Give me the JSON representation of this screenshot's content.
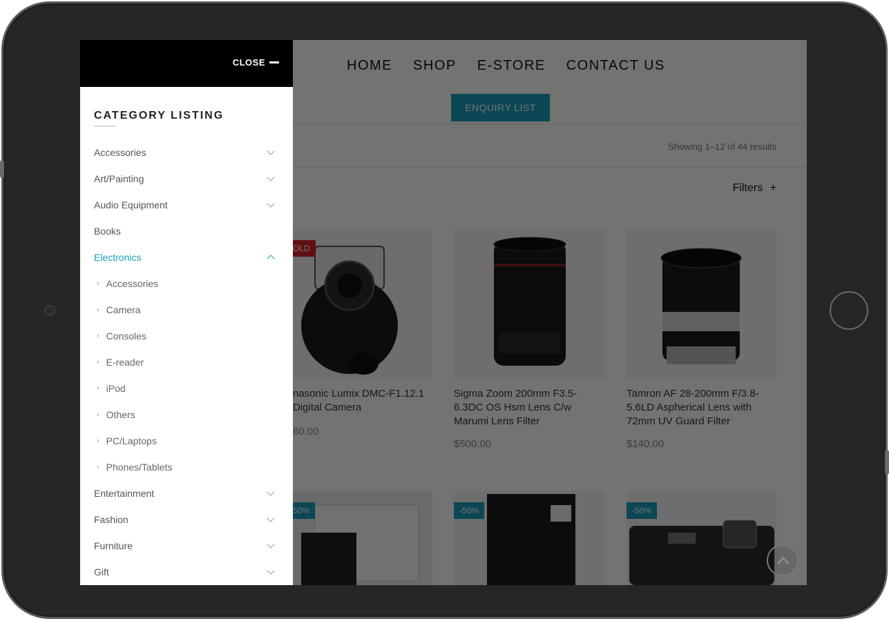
{
  "nav": {
    "items": [
      "HOME",
      "SHOP",
      "E-STORE",
      "CONTACT US"
    ]
  },
  "enquiry_label": "ENQUIRY LIST",
  "results_text": "Showing 1–12 of 44 results",
  "filters_label": "Filters",
  "filters_icon": "+",
  "products": [
    {
      "title": "nasonic Lumix DMC-F1.12.1 Digital Camera",
      "price": "60.00",
      "badge": "OLD",
      "badge_color": "#d9232d"
    },
    {
      "title": "Sigma Zoom 200mm F3.5-6.3DC OS Hsm Lens C/w Marumi Lens Filter",
      "price": "$500.00",
      "badge": ""
    },
    {
      "title": "Tamron AF 28-200mm F/3.8-5.6LD Aspherical Lens with 72mm UV Guard Filter",
      "price": "$140.00",
      "badge": ""
    },
    {
      "title": "",
      "price": "",
      "badge": "50%",
      "badge_color": "#1a9dbd"
    },
    {
      "title": "",
      "price": "",
      "badge": "-50%",
      "badge_color": "#1a9dbd"
    },
    {
      "title": "",
      "price": "",
      "badge": "-50%",
      "badge_color": "#1a9dbd"
    }
  ],
  "drawer": {
    "close_label": "CLOSE",
    "title": "CATEGORY LISTING",
    "categories": [
      {
        "label": "Accessories",
        "expandable": true
      },
      {
        "label": "Art/Painting",
        "expandable": true
      },
      {
        "label": "Audio Equipment",
        "expandable": true
      },
      {
        "label": "Books",
        "expandable": false
      },
      {
        "label": "Electronics",
        "expandable": true,
        "active": true
      },
      {
        "label": "Entertainment",
        "expandable": true
      },
      {
        "label": "Fashion",
        "expandable": true
      },
      {
        "label": "Furniture",
        "expandable": true
      },
      {
        "label": "Gift",
        "expandable": true
      }
    ],
    "subcategories": [
      "Accessories",
      "Camera",
      "Consoles",
      "E-reader",
      "iPod",
      "Others",
      "PC/Laptops",
      "Phones/Tablets"
    ]
  },
  "colors": {
    "accent": "#1a9dbd",
    "sold": "#d9232d",
    "drawer_header": "#000000"
  }
}
